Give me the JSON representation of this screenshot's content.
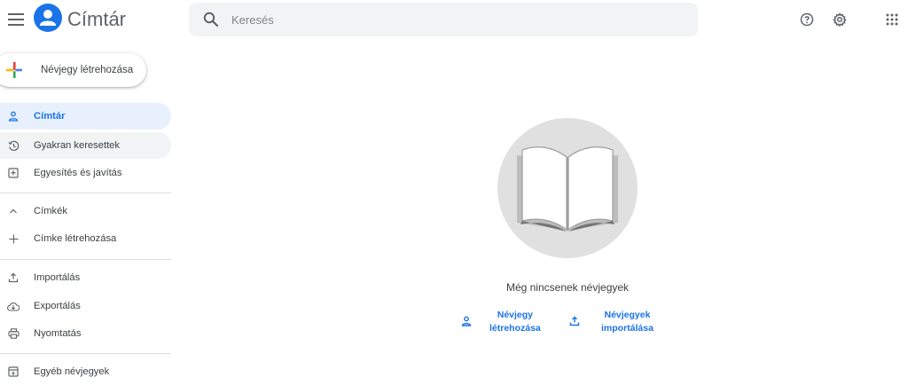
{
  "header": {
    "title": "Címtár",
    "search_placeholder": "Keresés",
    "menu_icon": "hamburger-menu-icon",
    "help_icon": "help-icon",
    "settings_icon": "settings-icon",
    "apps_icon": "apps-grid-icon"
  },
  "create_button": {
    "label": "Névjegy létrehozása",
    "icon": "multicolor-plus-icon"
  },
  "sidebar": {
    "items": [
      {
        "label": "Címtár",
        "icon": "person-icon",
        "state": "active"
      },
      {
        "label": "Gyakran keresettek",
        "icon": "history-icon",
        "state": "hover"
      },
      {
        "label": "Egyesítés és javítás",
        "icon": "merge-icon"
      },
      {
        "label": "Címkék",
        "icon": "chevron-up-icon"
      },
      {
        "label": "Címke létrehozása",
        "icon": "plus-icon"
      },
      {
        "label": "Importálás",
        "icon": "upload-icon"
      },
      {
        "label": "Exportálás",
        "icon": "cloud-download-icon"
      },
      {
        "label": "Nyomtatás",
        "icon": "print-icon"
      },
      {
        "label": "Egyéb névjegyek",
        "icon": "archive-icon"
      }
    ]
  },
  "empty_state": {
    "message": "Még nincsenek névjegyek",
    "illustration": "open-book-illustration",
    "actions": [
      {
        "line1": "Névjegy",
        "line2": "létrehozása",
        "icon": "person-icon"
      },
      {
        "line1": "Névjegyek",
        "line2": "importálása",
        "icon": "upload-icon"
      }
    ]
  },
  "colors": {
    "accent": "#1a73e8",
    "active_bg": "#e8f0fe",
    "search_bg": "#f1f3f4",
    "illustration_bg": "#e0e0e0",
    "text_secondary": "#5f6368"
  }
}
